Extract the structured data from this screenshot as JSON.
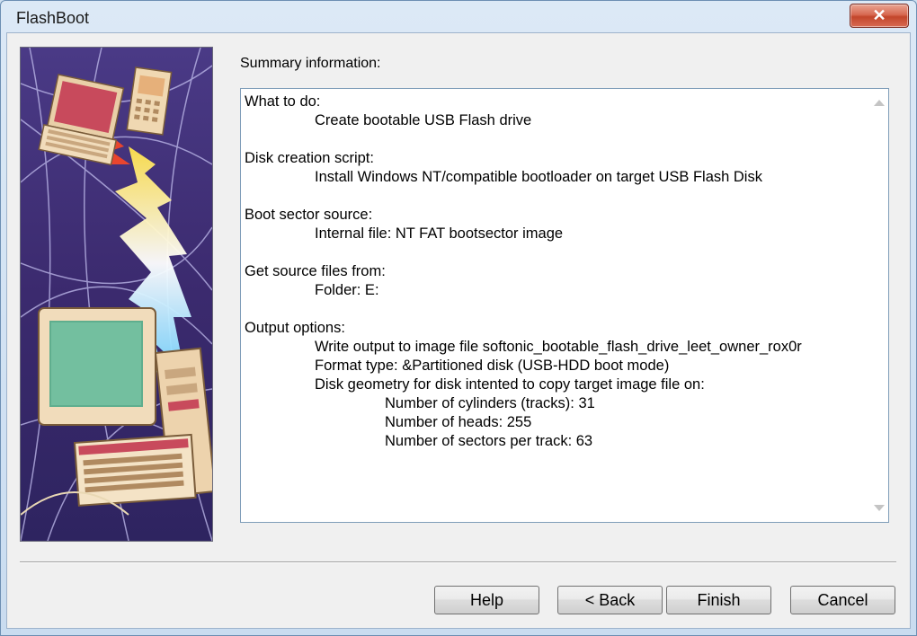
{
  "window": {
    "title": "FlashBoot",
    "close_label": "✕"
  },
  "summary": {
    "label": "Summary information:",
    "lines": [
      {
        "text": "What to do:",
        "indent": 0
      },
      {
        "text": "Create bootable USB Flash drive",
        "indent": 1
      },
      {
        "text": "",
        "indent": 0
      },
      {
        "text": "Disk creation script:",
        "indent": 0
      },
      {
        "text": "Install Windows NT/compatible bootloader on target USB Flash Disk",
        "indent": 1
      },
      {
        "text": "",
        "indent": 0
      },
      {
        "text": "Boot sector source:",
        "indent": 0
      },
      {
        "text": "Internal file: NT FAT bootsector image",
        "indent": 1
      },
      {
        "text": "",
        "indent": 0
      },
      {
        "text": "Get source files from:",
        "indent": 0
      },
      {
        "text": "Folder: E:",
        "indent": 1
      },
      {
        "text": "",
        "indent": 0
      },
      {
        "text": "Output options:",
        "indent": 0
      },
      {
        "text": "Write output to image file softonic_bootable_flash_drive_leet_owner_rox0r",
        "indent": 1
      },
      {
        "text": "Format type: &Partitioned disk (USB-HDD boot mode)",
        "indent": 1
      },
      {
        "text": "Disk geometry for disk intented to copy target image file on:",
        "indent": 1
      },
      {
        "text": "Number of cylinders (tracks): 31",
        "indent": 2
      },
      {
        "text": "Number of heads: 255",
        "indent": 2
      },
      {
        "text": "Number of sectors per track: 63",
        "indent": 2
      }
    ]
  },
  "buttons": {
    "help": "Help",
    "back": "< Back",
    "finish": "Finish",
    "cancel": "Cancel"
  },
  "colors": {
    "close_button": "#c3462b",
    "image_background": "#3b2a6e",
    "text_box_border": "#7f9db9"
  }
}
